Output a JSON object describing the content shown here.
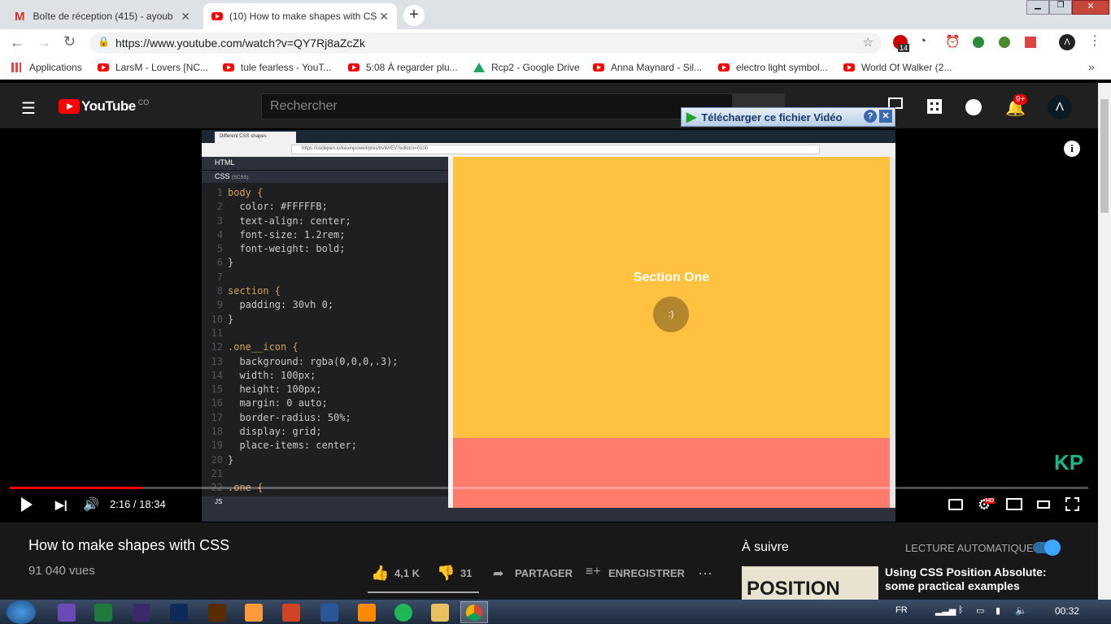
{
  "browser": {
    "tabs": [
      {
        "title": "Boîte de réception (415) - ayoub"
      },
      {
        "title": "(10) How to make shapes with CS"
      }
    ],
    "url": "https://www.youtube.com/watch?v=QY7Rj8aZcZk",
    "bookmarks": [
      "Applications",
      "LarsM - Lovers [NC...",
      "tule fearless - YouT...",
      "5:08 À regarder plu...",
      "Rcp2 - Google Drive",
      "Anna Maynard - Sil...",
      "electro light symbol...",
      "World Of Walker (2..."
    ],
    "ext_badge": "14",
    "avatar_letter": "Λ"
  },
  "youtube": {
    "logo": "YouTube",
    "logo_country": "CO",
    "search_placeholder": "Rechercher",
    "notif_badge": "9+",
    "download_banner": "Télécharger ce fichier Vidéo",
    "avatar_letter": "Λ"
  },
  "video": {
    "inner_tab": "Different CSS shapes",
    "inner_url": "https://codepen.io/kevinpowell/pres/bvWrEV?editors=0100",
    "html_panel": "HTML",
    "css_panel": "CSS",
    "css_sub": "(SCSS)",
    "js_panel": "JS",
    "section_title": "Section One",
    "circle_text": ":)",
    "watermark": "KP",
    "time": "2:16 / 18:34",
    "progress_fraction": 0.123
  },
  "code_lines": [
    {
      "n": "1",
      "t": "body {"
    },
    {
      "n": "2",
      "t": "  color: #FFFFFB;"
    },
    {
      "n": "3",
      "t": "  text-align: center;"
    },
    {
      "n": "4",
      "t": "  font-size: 1.2rem;"
    },
    {
      "n": "5",
      "t": "  font-weight: bold;"
    },
    {
      "n": "6",
      "t": "}"
    },
    {
      "n": "7",
      "t": ""
    },
    {
      "n": "8",
      "t": "section {"
    },
    {
      "n": "9",
      "t": "  padding: 30vh 0;"
    },
    {
      "n": "10",
      "t": "}"
    },
    {
      "n": "11",
      "t": ""
    },
    {
      "n": "12",
      "t": ".one__icon {"
    },
    {
      "n": "13",
      "t": "  background: rgba(0,0,0,.3);"
    },
    {
      "n": "14",
      "t": "  width: 100px;"
    },
    {
      "n": "15",
      "t": "  height: 100px;"
    },
    {
      "n": "16",
      "t": "  margin: 0 auto;"
    },
    {
      "n": "17",
      "t": "  border-radius: 50%;"
    },
    {
      "n": "18",
      "t": "  display: grid;"
    },
    {
      "n": "19",
      "t": "  place-items: center;"
    },
    {
      "n": "20",
      "t": "}"
    },
    {
      "n": "21",
      "t": ""
    },
    {
      "n": "22",
      "t": ".one {"
    }
  ],
  "info": {
    "title": "How to make shapes with CSS",
    "views": "91 040 vues",
    "likes": "4,1 K",
    "dislikes": "31",
    "share": "PARTAGER",
    "save": "ENREGISTRER",
    "up_next": "À suivre",
    "autoplay": "LECTURE AUTOMATIQUE",
    "next_title": "Using CSS Position Absolute: some practical examples",
    "next_thumb": "POSITION"
  },
  "taskbar": {
    "lang": "FR",
    "clock": "00:32"
  }
}
